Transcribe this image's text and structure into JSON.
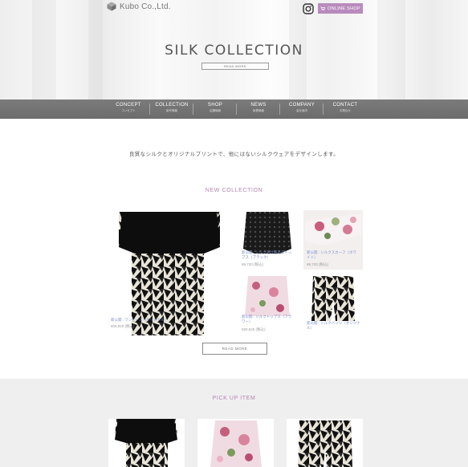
{
  "header": {
    "logo_text": "Kubo Co.,Ltd.",
    "shop_button": "ONLINE SHOP",
    "accent_color": "#b98bbd"
  },
  "hero": {
    "title": "SILK COLLECTION",
    "button": "READ MORE"
  },
  "nav": {
    "items": [
      {
        "en": "CONCEPT",
        "jp": "コンセプト"
      },
      {
        "en": "COLLECTION",
        "jp": "新作情報"
      },
      {
        "en": "SHOP",
        "jp": "店舗情報"
      },
      {
        "en": "NEWS",
        "jp": "新着情報"
      },
      {
        "en": "COMPANY",
        "jp": "会社案内"
      },
      {
        "en": "CONTACT",
        "jp": "お問合せ"
      }
    ]
  },
  "intro": {
    "tagline": "良質なシルクとオリジナルプリントで、他にはないシルクウェアをデザインします。"
  },
  "new_collection": {
    "title": "NEW COLLECTION",
    "items": [
      {
        "caption": "新公開 : ワンピース（オリジナル）",
        "price": "¥25,920 (税込)"
      },
      {
        "caption": "新公開 : シルク透け感あるトップス（ブラック）",
        "price": "¥9,720 (税込)"
      },
      {
        "caption": "新公開 : シルクスカーフ（ホワイト）",
        "price": "¥9,720 (税込)"
      },
      {
        "caption": "新公開 : シルクトップス（フラワー）",
        "price": "¥20,520 (税込)"
      },
      {
        "caption": "新公開 : シルクパンツ（オリジナル）",
        "price": ""
      }
    ],
    "read_more": "READ MORE"
  },
  "pickup": {
    "title": "PICK UP ITEM"
  }
}
